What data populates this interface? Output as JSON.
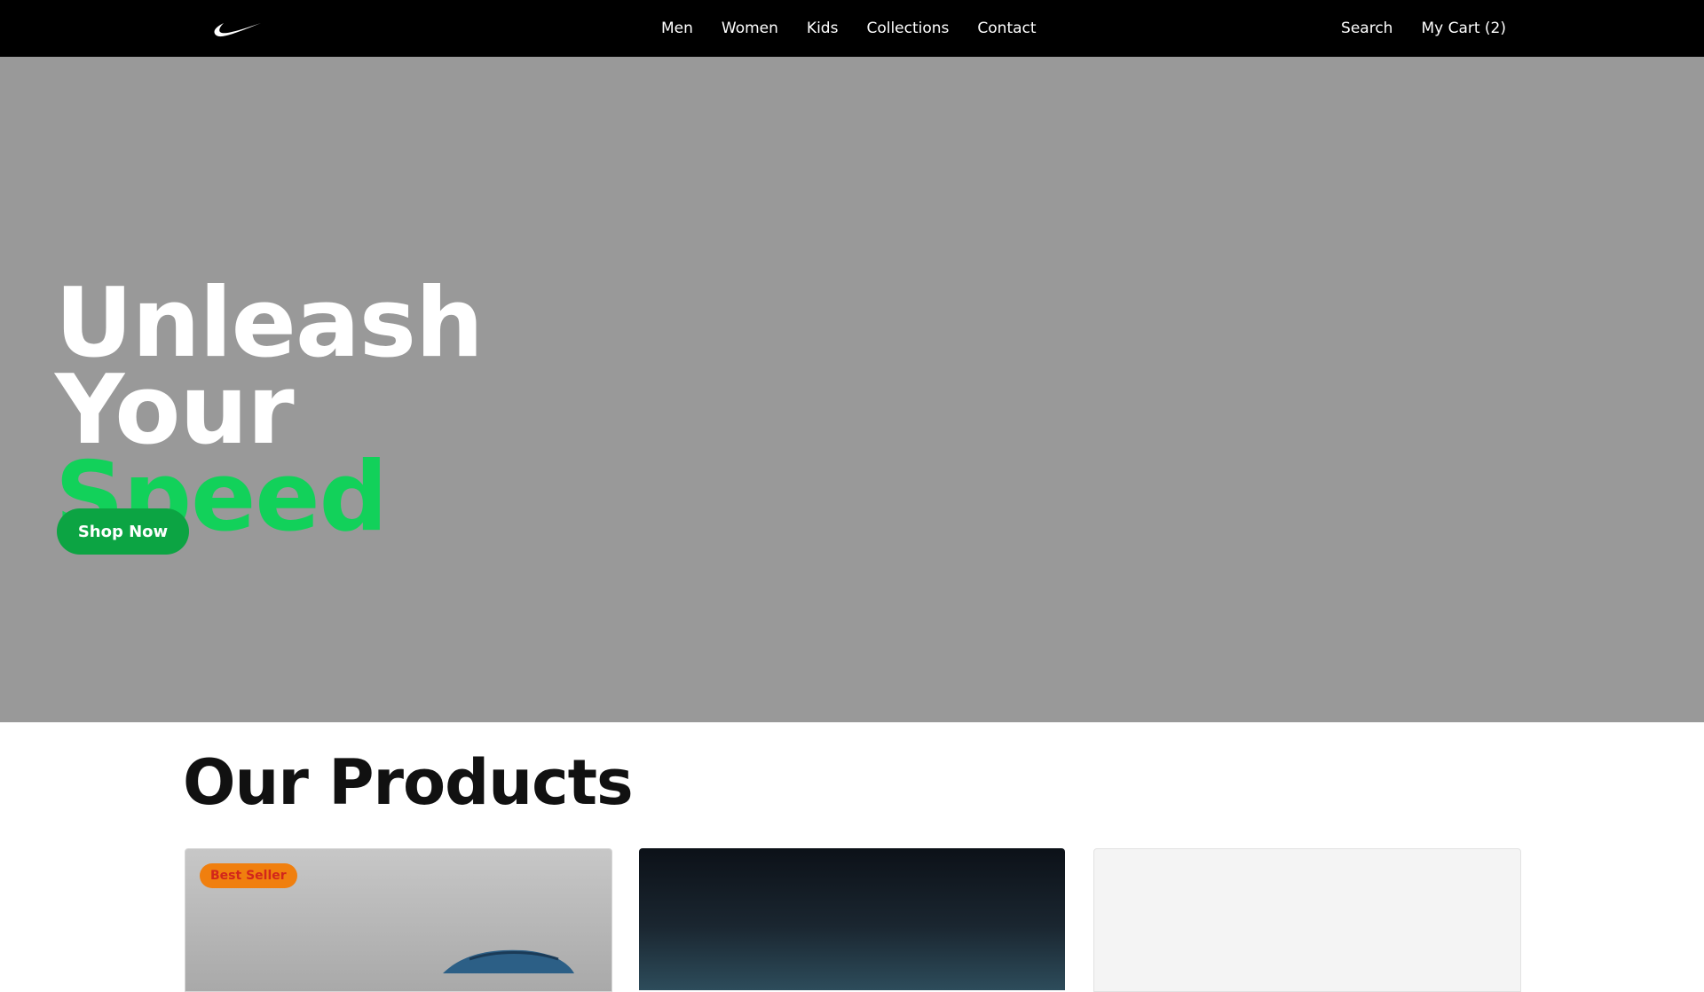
{
  "header": {
    "logo_icon": "swoosh-logo-icon",
    "nav": [
      {
        "label": "Men"
      },
      {
        "label": "Women"
      },
      {
        "label": "Kids"
      },
      {
        "label": "Collections"
      },
      {
        "label": "Contact"
      }
    ],
    "search_label": "Search",
    "cart_label": "My Cart (2)"
  },
  "hero": {
    "title_line1": "Unleash",
    "title_line2": "Your",
    "title_line3": "Speed",
    "cta_label": "Shop Now",
    "background_color": "#999999",
    "accent_color": "#12d15a",
    "button_color": "#0ca443"
  },
  "products": {
    "title": "Our Products",
    "cards": [
      {
        "badge": "Best Seller",
        "image_icon": "sneaker-image-icon"
      },
      {
        "image_icon": "product-image-dark"
      },
      {
        "image_icon": "product-image-light"
      }
    ],
    "badge_color": "#f07f0e"
  }
}
